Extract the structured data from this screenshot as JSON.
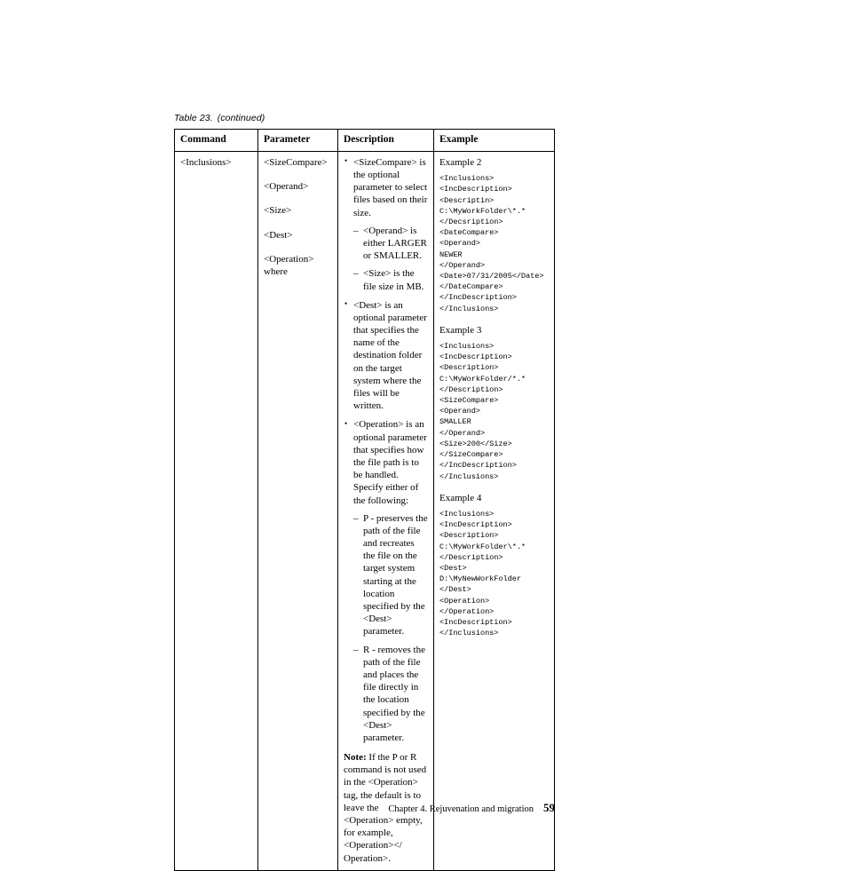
{
  "table": {
    "caption_number": "Table 23.",
    "caption_note": "(continued)",
    "headers": {
      "command": "Command",
      "parameter": "Parameter",
      "description": "Description",
      "example": "Example"
    },
    "row": {
      "command": "<Inclusions>",
      "parameters": [
        "<SizeCompare>",
        "<Operand>",
        "<Size>",
        "<Dest>",
        "<Operation>"
      ],
      "parameter_last_extra": "where",
      "description": {
        "bullets": [
          {
            "marker": "•",
            "text": "<SizeCompare> is the optional parameter to select files based on their size.",
            "sub": [
              {
                "marker": "–",
                "text": "<Operand> is either LARGER or SMALLER."
              },
              {
                "marker": "–",
                "text": "<Size> is the file size in MB."
              }
            ]
          },
          {
            "marker": "•",
            "text": "<Dest> is an optional parameter that specifies the name of the destination folder on the target system where the files will be written.",
            "sub": []
          },
          {
            "marker": "•",
            "text": "<Operation> is an optional parameter that specifies how the file path is to be handled. Specify either of the following:",
            "sub": [
              {
                "marker": "–",
                "text": "P - preserves the path of the file and recreates the file on the target system starting at the location specified by the <Dest> parameter."
              },
              {
                "marker": "–",
                "text": "R - removes the path of the file and places the file directly in the location specified by the <Dest> parameter."
              }
            ]
          }
        ],
        "note_label": "Note:",
        "note_text": "If the P or R command is not used in the <Operation> tag, the default is to leave the <Operation> empty, for example, <Operation></ Operation>."
      },
      "examples": [
        {
          "title": "Example 2",
          "code": "<Inclusions>\n<IncDescription>\n<Descriptin>\nC:\\MyWorkFolder\\*.*\n</Decsription>\n<DateCompare>\n<Operand>\nNEWER\n</Operand>\n<Date>07/31/2005</Date>\n</DateCompare>\n</IncDescription>\n</Inclusions>"
        },
        {
          "title": "Example 3",
          "code": "<Inclusions>\n<IncDescription>\n<Description>\nC:\\MyWorkFolder/*.*\n</Description>\n<SizeCompare>\n<Operand>\nSMALLER\n</Operand>\n<Size>200</Size>\n</SizeCompare>\n</IncDescription>\n</Inclusions>"
        },
        {
          "title": "Example 4",
          "code": "<Inclusions>\n<IncDescription>\n<Description>\nC:\\MyWorkFolder\\*.*\n</Description>\n<Dest>\nD:\\MyNewWorkFolder\n</Dest>\n<Operation>\n</Operation>\n<IncDescription>\n</Inclusions>"
        }
      ]
    }
  },
  "footer": {
    "chapter": "Chapter 4. Rejuvenation and migration",
    "page_number": "59"
  }
}
